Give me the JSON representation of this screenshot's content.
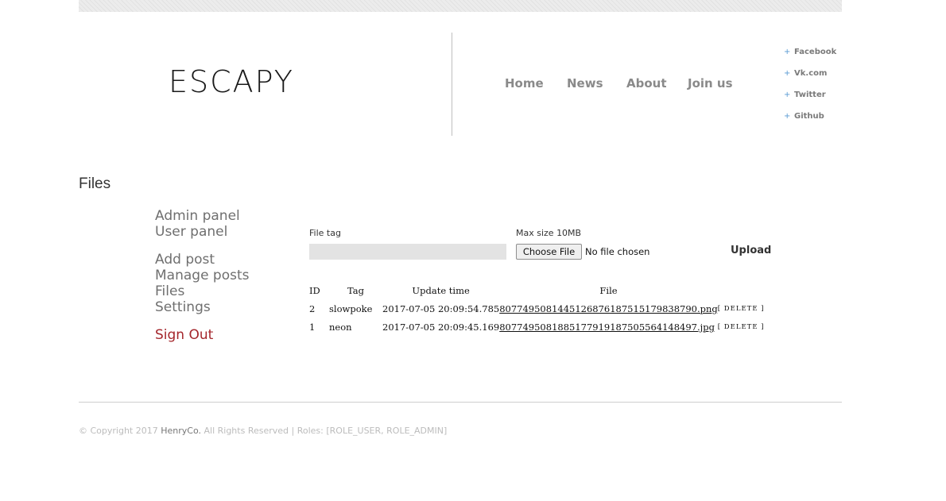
{
  "header": {
    "logo_text": "ESCAPY",
    "nav": [
      "Home",
      "News",
      "About",
      "Join us"
    ],
    "social": [
      "Facebook",
      "Vk.com",
      "Twitter",
      "Github"
    ],
    "social_bullet": "+"
  },
  "page": {
    "title": "Files"
  },
  "sidebar": {
    "group1": [
      "Admin panel",
      "User panel"
    ],
    "group2": [
      "Add post",
      "Manage posts",
      "Files",
      "Settings"
    ],
    "sign_out": "Sign Out"
  },
  "upload_form": {
    "tag_label": "File tag",
    "tag_value": "",
    "max_size_label": "Max size 10MB",
    "choose_button": "Choose File",
    "no_file_text": "No file chosen",
    "upload_button": "Upload"
  },
  "files_table": {
    "columns": [
      "ID",
      "Tag",
      "Update time",
      "File"
    ],
    "rows": [
      {
        "id": "2",
        "tag": "slowpoke",
        "time": "2017-07-05 20:09:54.785",
        "file": "807749508144512687618751517983879​0.png",
        "action": "[ DELETE ]"
      },
      {
        "id": "1",
        "tag": "neon",
        "time": "2017-07-05 20:09:45.169",
        "file": "807749508188517791918750556414849​7.jpg",
        "action": "[ DELETE ]"
      }
    ]
  },
  "footer": {
    "prefix": "© Copyright 2017 ",
    "company": "HenryCo.",
    "suffix": " All Rights Reserved | Roles: [ROLE_USER, ROLE_ADMIN]"
  },
  "colors": {
    "sign_out": "#a4262c",
    "social_bullet": "#5a9bd3",
    "input_bg": "#e3e3e3"
  }
}
